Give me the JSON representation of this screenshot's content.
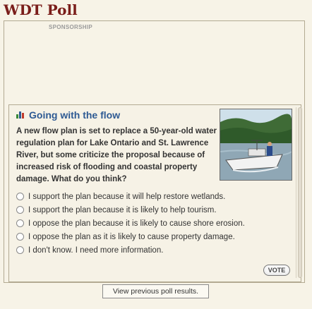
{
  "header": {
    "title": "WDT Poll"
  },
  "sponsor": {
    "label": "SPONSORSHIP"
  },
  "poll": {
    "icon": "poll-bar-chart-icon",
    "title": "Going with the flow",
    "question": "A new flow plan is set to replace a 50-year-old water regulation plan for Lake Ontario and St. Lawrence River, but some criticize the proposal because of increased risk of flooding and coastal property damage. What do you think?",
    "photo": "boat-on-river-photo",
    "options": [
      "I support the plan because it will help restore wetlands.",
      "I support the plan because it is likely to help tourism.",
      "I oppose the plan because it is likely to cause shore erosion.",
      "I oppose the plan as it is likely to cause property damage.",
      "I don't know. I need more information."
    ],
    "vote_label": "VOTE"
  },
  "footer": {
    "previous_label": "View previous poll results."
  },
  "colors": {
    "title": "#7a1d1a",
    "poll_title": "#2e5a93",
    "background": "#f7f3e7"
  }
}
